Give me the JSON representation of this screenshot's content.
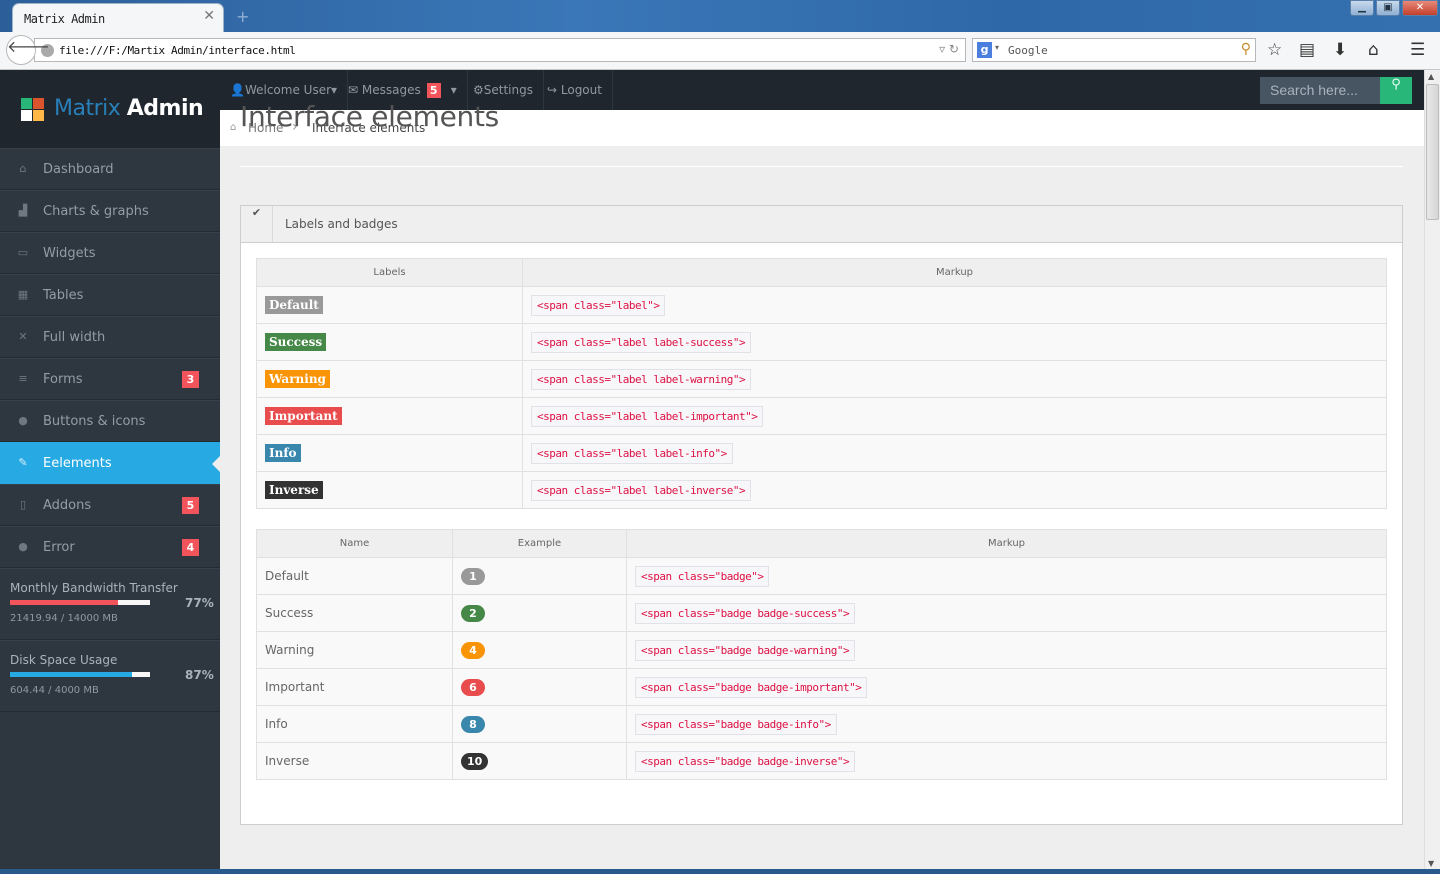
{
  "browser": {
    "tab_title": "Matrix Admin",
    "tab_close": "✕",
    "new_tab": "+",
    "url": "file:///F:/Martix Admin/interface.html",
    "search_engine_placeholder": "Google",
    "window_buttons": [
      "minimize",
      "restore",
      "close"
    ]
  },
  "app": {
    "logo": {
      "part1": "Matrix",
      "part2": "Admin",
      "colors": [
        "#28b779",
        "#da542e",
        "#ffffff",
        "#ffb848"
      ]
    },
    "topnav": {
      "welcome": "Welcome User",
      "messages": "Messages",
      "messages_count": "5",
      "settings": "Settings",
      "logout": "Logout",
      "search_placeholder": "Search here..."
    },
    "breadcrumb": {
      "home": "Home",
      "current": "Interface elements"
    },
    "sidebar": {
      "items": [
        {
          "label": "Dashboard",
          "icon": "home-icon",
          "glyph": "⌂"
        },
        {
          "label": "Charts & graphs",
          "icon": "signal-icon",
          "glyph": "▟"
        },
        {
          "label": "Widgets",
          "icon": "inbox-icon",
          "glyph": "▭"
        },
        {
          "label": "Tables",
          "icon": "table-icon",
          "glyph": "▦"
        },
        {
          "label": "Full width",
          "icon": "fullscreen-icon",
          "glyph": "✕"
        },
        {
          "label": "Forms",
          "icon": "list-icon",
          "glyph": "≡",
          "badge": "3"
        },
        {
          "label": "Buttons & icons",
          "icon": "tint-icon",
          "glyph": "●"
        },
        {
          "label": "Eelements",
          "icon": "pencil-icon",
          "glyph": "✎",
          "active": true
        },
        {
          "label": "Addons",
          "icon": "file-icon",
          "glyph": "▯",
          "badge": "5"
        },
        {
          "label": "Error",
          "icon": "info-sign-icon",
          "glyph": "●",
          "badge": "4"
        }
      ],
      "stats": [
        {
          "title": "Monthly Bandwidth Transfer",
          "value": "21419.94 / 14000 MB",
          "percent_label": "77%",
          "percent": 77,
          "color": "#f2545b"
        },
        {
          "title": "Disk Space Usage",
          "value": "604.44 / 4000 MB",
          "percent_label": "87%",
          "percent": 87,
          "color": "#27a9e3"
        }
      ]
    },
    "page_title": "Interface elements",
    "widget": {
      "title": "Labels and badges",
      "labels_table": {
        "headers": [
          "Labels",
          "Markup"
        ],
        "rows": [
          {
            "label": "Default",
            "color": "#999999",
            "markup": "<span class=\"label\">"
          },
          {
            "label": "Success",
            "color": "#468847",
            "markup": "<span class=\"label label-success\">"
          },
          {
            "label": "Warning",
            "color": "#f89406",
            "markup": "<span class=\"label label-warning\">"
          },
          {
            "label": "Important",
            "color": "#e84c4c",
            "markup": "<span class=\"label label-important\">"
          },
          {
            "label": "Info",
            "color": "#3a87ad",
            "markup": "<span class=\"label label-info\">"
          },
          {
            "label": "Inverse",
            "color": "#333333",
            "markup": "<span class=\"label label-inverse\">"
          }
        ]
      },
      "badges_table": {
        "headers": [
          "Name",
          "Example",
          "Markup"
        ],
        "rows": [
          {
            "name": "Default",
            "badge": "1",
            "color": "#999999",
            "markup": "<span class=\"badge\">"
          },
          {
            "name": "Success",
            "badge": "2",
            "color": "#468847",
            "markup": "<span class=\"badge badge-success\">"
          },
          {
            "name": "Warning",
            "badge": "4",
            "color": "#f89406",
            "markup": "<span class=\"badge badge-warning\">"
          },
          {
            "name": "Important",
            "badge": "6",
            "color": "#e84c4c",
            "markup": "<span class=\"badge badge-important\">"
          },
          {
            "name": "Info",
            "badge": "8",
            "color": "#3a87ad",
            "markup": "<span class=\"badge badge-info\">"
          },
          {
            "name": "Inverse",
            "badge": "10",
            "color": "#333333",
            "markup": "<span class=\"badge badge-inverse\">"
          }
        ]
      }
    }
  }
}
